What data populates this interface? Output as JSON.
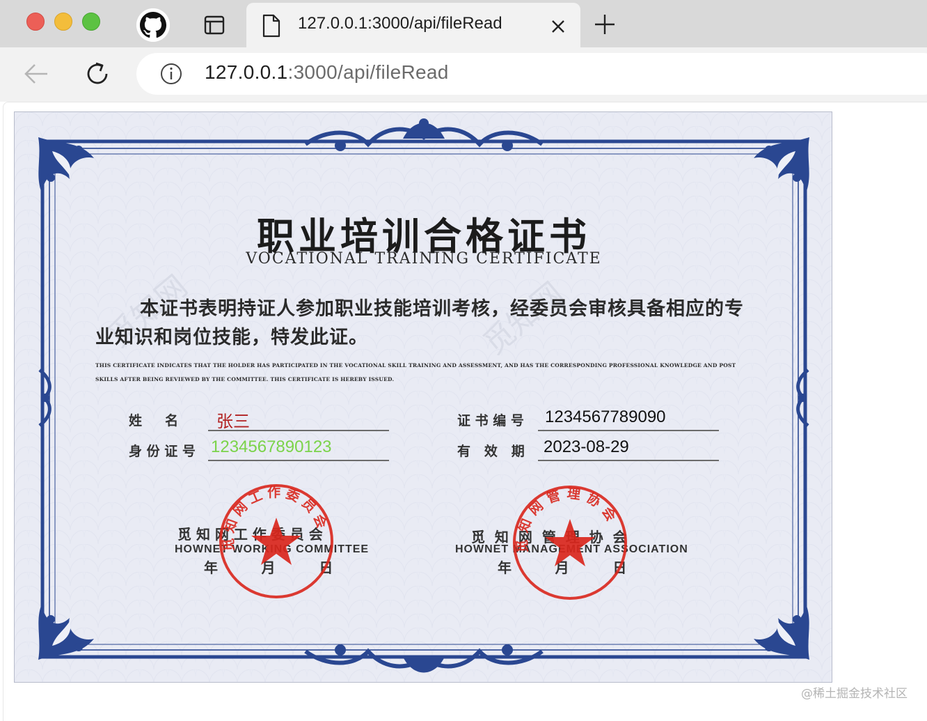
{
  "browser": {
    "tab": {
      "title": "127.0.0.1:3000/api/fileRead"
    },
    "address_bar": {
      "host": "127.0.0.1",
      "path": ":3000/api/fileRead"
    },
    "icons": [
      "github-icon",
      "sidebar-icon",
      "file-icon",
      "close-icon",
      "plus-icon",
      "back-arrow-icon",
      "reload-icon",
      "info-icon"
    ]
  },
  "certificate": {
    "title_zh": "职业培训合格证书",
    "title_en": "VOCATIONAL TRAINING CERTIFICATE",
    "body_zh": "本证书表明持证人参加职业技能培训考核，经委员会审核具备相应的专业知识和岗位技能，特发此证。",
    "body_en": "THIS CERTIFICATE INDICATES THAT THE HOLDER HAS PARTICIPATED IN THE VOCATIONAL SKILL TRAINING AND ASSESSMENT, AND HAS THE CORRESPONDING PROFESSIONAL KNOWLEDGE AND POST SKILLS AFTER BEING REVIEWED BY THE COMMITTEE. THIS CERTIFICATE IS HEREBY ISSUED.",
    "watermark_text": "觅知网",
    "fields": {
      "name_label": "姓     名",
      "name_value": "张三",
      "id_label": "身 份 证 号",
      "id_value": "1234567890123",
      "cert_no_label": "证 书 编 号",
      "cert_no_value": "1234567789090",
      "valid_label": "有   效   期",
      "valid_value": "2023-08-29"
    },
    "signatures": [
      {
        "org_zh": "觅 知 网 工 作 委 员 会",
        "org_en": "HOWNET WORKING COMMITTEE",
        "date_zh": "年         月         日",
        "seal_text": "觅知网工作委员会"
      },
      {
        "org_zh": "觅  知  网  管  理  协  会",
        "org_en": "HOWNET MANAGEMENT ASSOCIATION",
        "date_zh": "年         月         日",
        "seal_text": "觅知网管理协会"
      }
    ]
  },
  "footer_watermark": "@稀土掘金技术社区",
  "colors": {
    "border_blue": "#27468e",
    "cert_bg": "#e9ebf4",
    "name_value": "#b22222",
    "id_value": "#7bd34a",
    "seal_red": "#d9261c"
  }
}
